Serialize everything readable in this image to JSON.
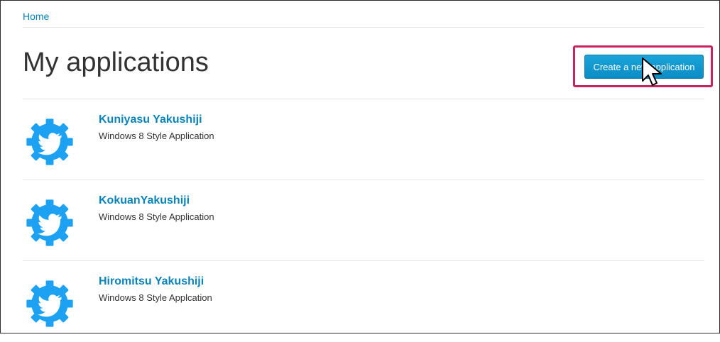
{
  "breadcrumb": {
    "home_label": "Home"
  },
  "page": {
    "title": "My applications"
  },
  "actions": {
    "create_label": "Create a new application"
  },
  "apps": [
    {
      "name": "Kuniyasu Yakushiji",
      "description": "Windows 8 Style Application",
      "icon": "twitter-gear-icon"
    },
    {
      "name": "KokuanYakushiji",
      "description": "Windows 8 Style Application",
      "icon": "twitter-gear-icon"
    },
    {
      "name": "Hiromitsu Yakushiji",
      "description": "Windows 8 Style Applcation",
      "icon": "twitter-gear-icon"
    }
  ],
  "colors": {
    "link": "#0a84b8",
    "button": "#1aa5d8",
    "highlight": "#c8235a",
    "icon": "#1da1f2"
  }
}
